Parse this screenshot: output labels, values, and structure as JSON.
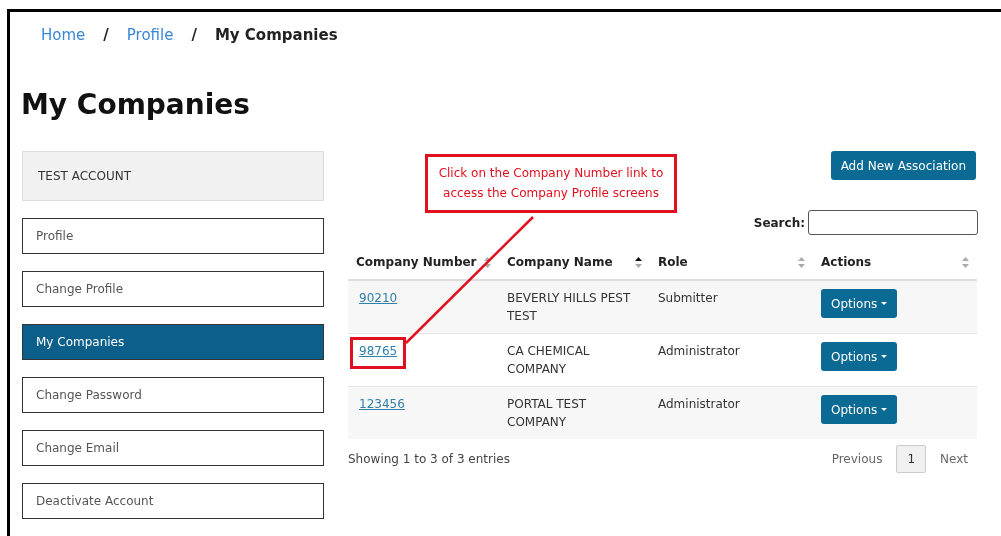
{
  "breadcrumb": [
    {
      "label": "Home",
      "kind": "link"
    },
    {
      "label": "/",
      "kind": "separator"
    },
    {
      "label": "Profile",
      "kind": "link"
    },
    {
      "label": "/",
      "kind": "separator"
    },
    {
      "label": "My Companies",
      "kind": "current"
    }
  ],
  "title": "My Companies",
  "sidebar": {
    "header": "TEST ACCOUNT",
    "items": [
      {
        "label": "Profile",
        "selected": false
      },
      {
        "label": "Change Profile",
        "selected": false
      },
      {
        "label": "My Companies",
        "selected": true
      },
      {
        "label": "Change Password",
        "selected": false
      },
      {
        "label": "Change Email",
        "selected": false
      },
      {
        "label": "Deactivate Account",
        "selected": false
      }
    ]
  },
  "add_button": "Add New Association",
  "search": {
    "label": "Search:"
  },
  "table": {
    "columns": [
      {
        "label": "Company Number",
        "sorted": false
      },
      {
        "label": "Company Name",
        "sorted": true
      },
      {
        "label": "Role",
        "sorted": false
      },
      {
        "label": "Actions",
        "sorted": false
      }
    ],
    "rows": [
      {
        "number": "90210",
        "name": "BEVERLY HILLS PEST TEST",
        "role": "Submitter",
        "action": "Options",
        "highlighted": false
      },
      {
        "number": "98765",
        "name": "CA CHEMICAL COMPANY",
        "role": "Administrator",
        "action": "Options",
        "highlighted": true
      },
      {
        "number": "123456",
        "name": "PORTAL TEST COMPANY",
        "role": "Administrator",
        "action": "Options",
        "highlighted": false
      }
    ]
  },
  "info": "Showing 1 to 3 of 3 entries",
  "pagination": {
    "previous": "Previous",
    "pages": [
      {
        "label": "1",
        "selected": true
      }
    ],
    "next": "Next"
  },
  "callout": "Click on the Company Number link to access the Company Profile screens"
}
